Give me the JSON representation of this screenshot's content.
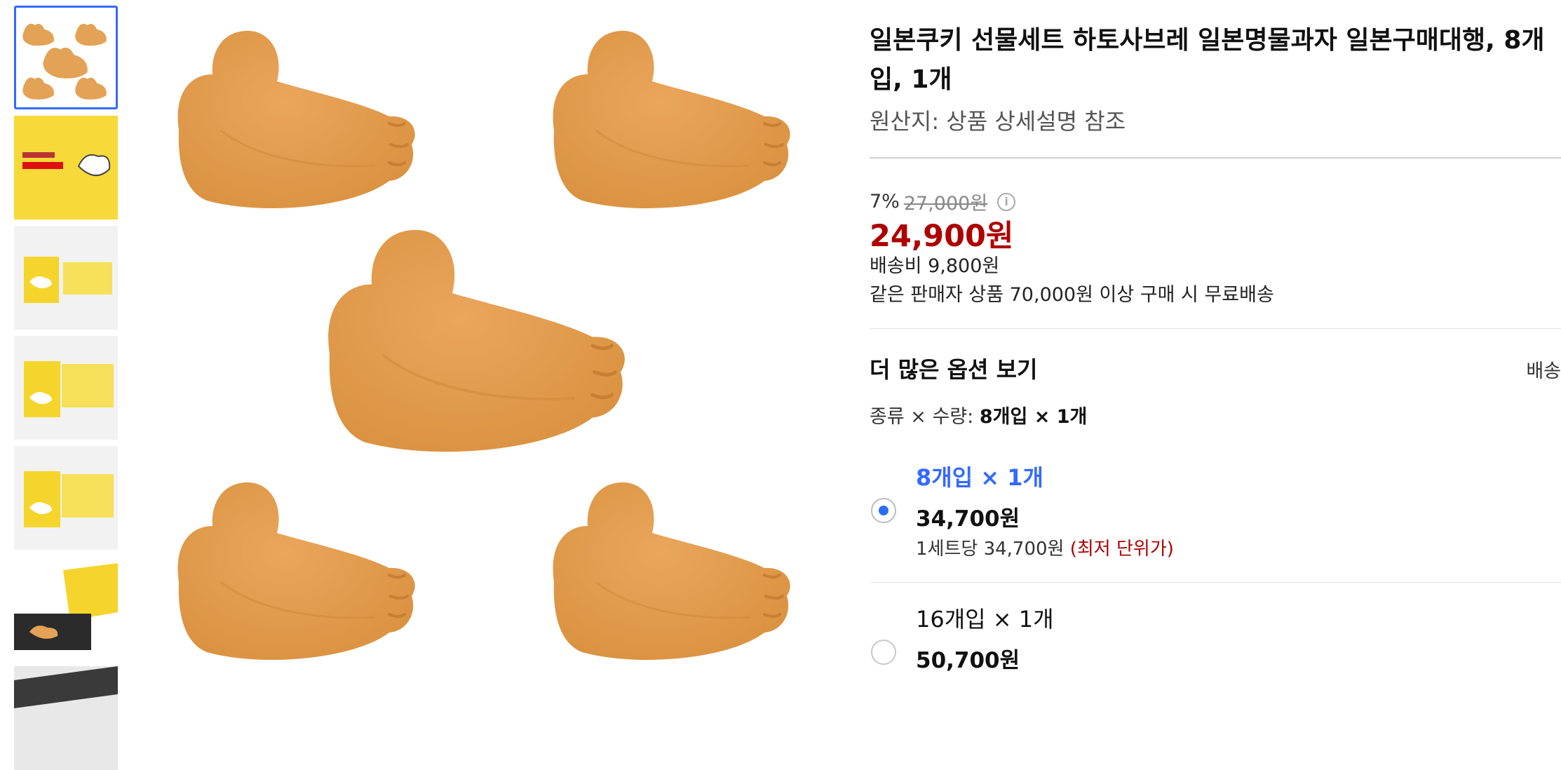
{
  "thumbnails": [
    {
      "name": "cookie-collage",
      "selected": true
    },
    {
      "name": "yellow-box-logo",
      "selected": false
    },
    {
      "name": "box-open-1",
      "selected": false
    },
    {
      "name": "box-open-2",
      "selected": false
    },
    {
      "name": "box-open-3",
      "selected": false
    },
    {
      "name": "box-with-tray",
      "selected": false
    },
    {
      "name": "dark-box",
      "selected": false
    }
  ],
  "product": {
    "title": "일본쿠키 선물세트 하토사브레 일본명물과자 일본구매대행, 8개입, 1개",
    "origin": "원산지: 상품 상세설명 참조",
    "discount_rate": "7%",
    "original_price": "27,000원",
    "sale_price": "24,900원",
    "shipping_fee": "배송비 9,800원",
    "free_shipping": "같은 판매자 상품 70,000원 이상 구매 시 무료배송"
  },
  "options": {
    "header": "더 많은 옵션 보기",
    "header_right": "배송",
    "type_qty_label": "종류 × 수량: ",
    "type_qty_value": "8개입 × 1개",
    "items": [
      {
        "label": "8개입 × 1개",
        "price": "34,700원",
        "unit": "1세트당 34,700원 ",
        "unit_note": "(최저 단위가)",
        "selected": true
      },
      {
        "label": "16개입 × 1개",
        "price": "50,700원",
        "selected": false
      }
    ]
  },
  "colors": {
    "accent_blue": "#346aff",
    "price_red": "#ae0000",
    "cookie": "#e3a255",
    "box_yellow": "#f7d93a"
  }
}
